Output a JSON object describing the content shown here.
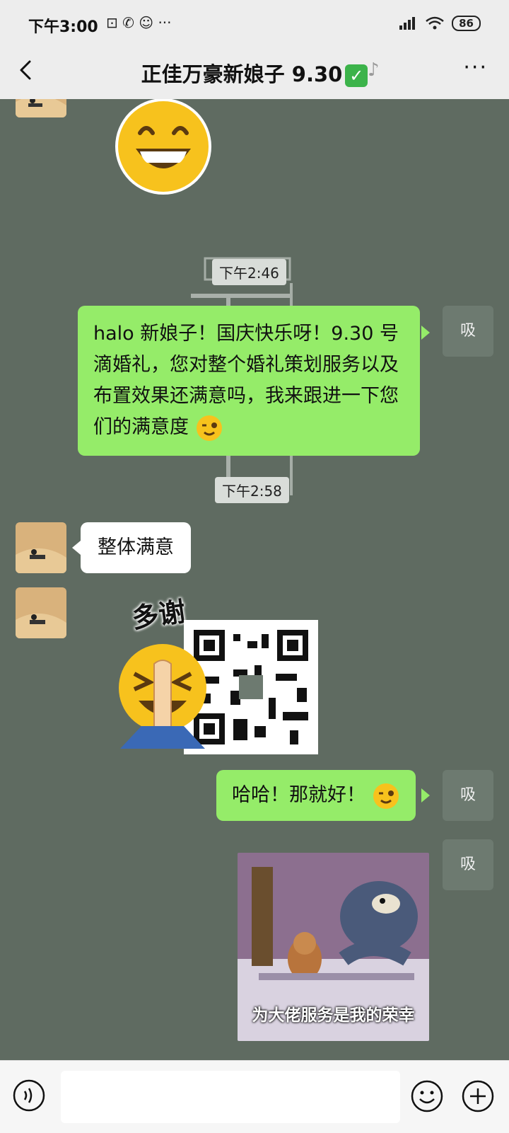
{
  "status": {
    "time": "下午3:00",
    "left_icons": "⊡ ✆ ☺ ···",
    "battery": "86"
  },
  "header": {
    "title": "正佳万豪新娘子 9.30",
    "badge": "✓"
  },
  "messages": {
    "time1": "下午2:46",
    "msg1": "halo 新娘子！国庆快乐呀！9.30 号滴婚礼，您对整个婚礼策划服务以及布置效果还满意吗，我来跟进一下您们的满意度",
    "time2": "下午2:58",
    "reply1": "整体满意",
    "sticker_text": "多谢",
    "msg2": "哈哈！那就好！",
    "meme_caption": "为大佬服务是我的荣幸"
  },
  "colors": {
    "chat_bg": "#5f6b61",
    "bubble_out": "#95ec69",
    "bubble_in": "#ffffff",
    "bar_bg": "#ededed"
  },
  "icons": [
    "back-arrow-icon",
    "ear-icon",
    "more-icon",
    "voice-icon",
    "emoji-icon",
    "plus-icon"
  ]
}
